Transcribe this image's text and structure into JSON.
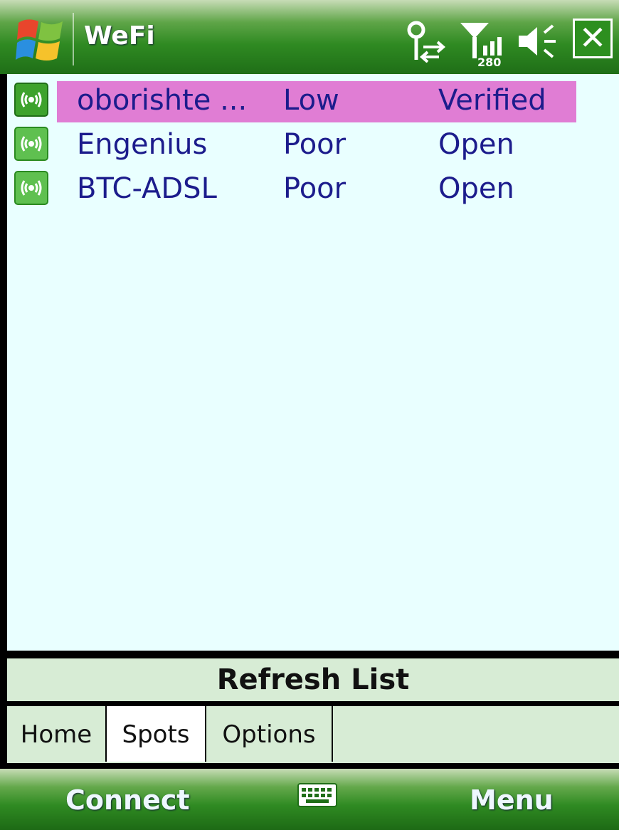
{
  "window": {
    "title": "WeFi",
    "status": {
      "signal_label": "280"
    }
  },
  "networks": [
    {
      "name": "oborishte ...",
      "signal": "Low",
      "security": "Verified",
      "selected": true
    },
    {
      "name": "Engenius",
      "signal": "Poor",
      "security": "Open",
      "selected": false
    },
    {
      "name": "BTC-ADSL",
      "signal": "Poor",
      "security": "Open",
      "selected": false
    }
  ],
  "refresh_label": "Refresh List",
  "tabs": [
    {
      "label": "Home",
      "active": false
    },
    {
      "label": "Spots",
      "active": true
    },
    {
      "label": "Options",
      "active": false
    }
  ],
  "softkeys": {
    "left": "Connect",
    "right": "Menu"
  },
  "colors": {
    "accent": "#2f8a22",
    "selection": "#e07dd4",
    "list_bg": "#e9ffff",
    "text_blue": "#1c1c8c"
  },
  "icons": [
    "windows-logo-icon",
    "connectivity-icon",
    "signal-icon",
    "volume-icon",
    "close-icon",
    "wifi-hotspot-icon",
    "keyboard-icon"
  ]
}
